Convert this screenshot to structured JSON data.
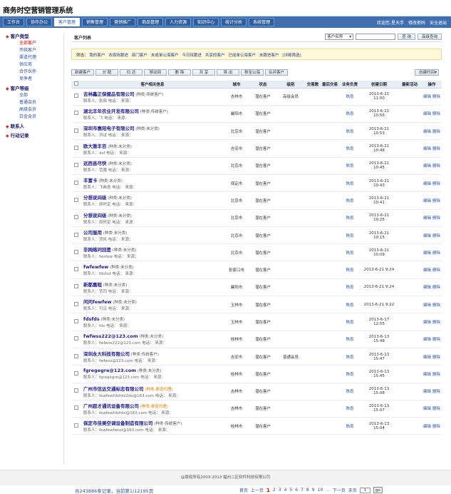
{
  "app": {
    "title": "商务时空营销管理系统"
  },
  "nav": {
    "tabs": [
      "工作台",
      "协作办公",
      "客户管理",
      "销售管理",
      "营销推广",
      "商品管理",
      "人力资源",
      "知识中心",
      "统计分析",
      "系统管理"
    ],
    "active_index": 2,
    "user_links": [
      "欢迎您,星天手",
      "修改密码",
      "安全退出"
    ]
  },
  "sidebar": {
    "groups": [
      {
        "label": "客户类型",
        "items": [
          "全部客户",
          "传统客户",
          "渠道代理",
          "供应商",
          "合作伙伴",
          "竞争者"
        ],
        "active_item": 0
      },
      {
        "label": "客户等级",
        "items": [
          "全部",
          "普通会员",
          "高级会员",
          "白金会员"
        ]
      },
      {
        "label": "联系人",
        "items": []
      },
      {
        "label": "行动记录",
        "items": []
      }
    ]
  },
  "list": {
    "title": "客户列表",
    "search_select": "客户名称",
    "search_placeholder": "",
    "search_button": "查 询",
    "advanced_button": "高级查询"
  },
  "filter": {
    "label": "筛选：",
    "items": [
      "我的客户",
      "本周待跟进",
      "部门客户",
      "未成单公海客户",
      "今日待跟进",
      "共享的客户",
      "已成单公海客户",
      "未跟进客户",
      "[详细筛选]"
    ]
  },
  "toolbar": {
    "buttons": [
      "新建客户",
      "分 配",
      "归 还",
      "移动到",
      "删 除",
      "共 享",
      "导 出",
      "移至公海",
      "合并客户"
    ],
    "sort": "创建时间"
  },
  "table": {
    "headers": [
      "",
      "客户相关信息",
      "城市",
      "状态",
      "级别",
      "交易数",
      "最后交易",
      "业务负责",
      "创建日期",
      "最新活动",
      "操作"
    ],
    "rows": [
      {
        "name": "吉林鑫正保健品有限公司",
        "type": "(种类:传统客户)",
        "type_color": "normal",
        "contact": "联系人：张田  电话：  来源：",
        "city": "吉林市",
        "status": "潜在客户",
        "level": "高级会员",
        "owner": "陈雨",
        "date": "2013-6-21",
        "time": "11:00",
        "ops": [
          "编辑",
          "删除"
        ]
      },
      {
        "name": "湖北丰年农业开发有限公司",
        "type": "(种类:传统客户)",
        "type_color": "normal",
        "contact": "联系人：飞  电话：  来源：",
        "city": "襄阳市",
        "status": "潜在客户",
        "level": "",
        "owner": "陈雨",
        "date": "2013-6-21",
        "time": "10:56",
        "ops": [
          "编辑",
          "删除"
        ]
      },
      {
        "name": "深圳市惠阳电子有限公司",
        "type": "(种类:未分类)",
        "type_color": "normal",
        "contact": "联系人：洪试  电话：  来源：",
        "city": "北京市",
        "status": "潜在客户",
        "level": "",
        "owner": "陈雨",
        "date": "2013-6-21",
        "time": "10:53",
        "ops": [
          "编辑",
          "删除"
        ]
      },
      {
        "name": "欧大雅丰百",
        "type": "(种类:未分类)",
        "type_color": "normal",
        "contact": "联系人：dsf  电话：  来源：",
        "city": "吉安市",
        "status": "潜在客户",
        "level": "",
        "owner": "陈雨",
        "date": "2013-6-21",
        "time": "10:48",
        "ops": [
          "编辑",
          "删除"
        ]
      },
      {
        "name": "远西县尽快",
        "type": "(种类:未分类)",
        "type_color": "normal",
        "contact": "联系人：范围  电话：  来源：",
        "city": "北京市",
        "status": "潜在客户",
        "level": "",
        "owner": "陈雨",
        "date": "2013-6-21",
        "time": "10:45",
        "ops": [
          "编辑",
          "删除"
        ]
      },
      {
        "name": "丰富卡",
        "type": "(种类:未分类)",
        "type_color": "normal",
        "contact": "联系人：飞画舍  电话：  来源：",
        "city": "保定市",
        "status": "潜在客户",
        "level": "",
        "owner": "陈雨",
        "date": "2013-6-21",
        "time": "10:43",
        "ops": [
          "编辑",
          "删除"
        ]
      },
      {
        "name": "分想说间级",
        "type": "(种类:未分类)",
        "type_color": "normal",
        "contact": "联系人：原时定  电话：  来源：",
        "city": "北京市",
        "status": "潜在客户",
        "level": "",
        "owner": "陈雨",
        "date": "2013-6-21",
        "time": "10:41",
        "ops": [
          "编辑",
          "删除"
        ]
      },
      {
        "name": "分想说间级",
        "type": "(种类:未分类)",
        "type_color": "normal",
        "contact": "联系人：原时定  电话：  来源：",
        "city": "北京市",
        "status": "潜在客户",
        "level": "",
        "owner": "陈雨",
        "date": "2013-6-21",
        "time": "10:25",
        "ops": [
          "编辑",
          "删除"
        ]
      },
      {
        "name": "公司服用",
        "type": "(种类:未分类)",
        "type_color": "normal",
        "contact": "联系人：顶风  电话：  来源：",
        "city": "北京市",
        "status": "潜在客户",
        "level": "",
        "owner": "陈雨",
        "date": "2013-6-21",
        "time": "10:15",
        "ops": [
          "编辑",
          "删除"
        ]
      },
      {
        "name": "非网络问回是",
        "type": "(种类:未分类)",
        "type_color": "normal",
        "contact": "联系人：fwsfew  电话：  来源：",
        "city": "北京市",
        "status": "潜在客户",
        "level": "",
        "owner": "陈雨",
        "date": "2013-6-21",
        "time": "10:09",
        "ops": [
          "编辑",
          "删除"
        ]
      },
      {
        "name": "fwfewfew",
        "type": "(种类:未分类)",
        "type_color": "normal",
        "contact": "联系人：fdsfsd  电话：  来源：",
        "city": "张家口市",
        "status": "潜在客户",
        "level": "",
        "owner": "陈雨",
        "date": "2013-6-21 9:24",
        "time": "",
        "ops": [
          "编辑",
          "删除"
        ]
      },
      {
        "name": "新都嘉程",
        "type": "(种类:未分类)",
        "type_color": "normal",
        "contact": "联系人：范司  电话：  来源：",
        "city": "襄阳市",
        "status": "潜在客户",
        "level": "",
        "owner": "陈雨",
        "date": "2013-6-21 9:24",
        "time": "",
        "ops": [
          "编辑",
          "删除"
        ]
      },
      {
        "name": "问问fewfew",
        "type": "(种类:未分类)",
        "type_color": "normal",
        "contact": "联系人：可见  电话：  来源：",
        "city": "玉林市",
        "status": "潜在客户",
        "level": "",
        "owner": "陈雨",
        "date": "2013-6-21 9:22",
        "time": "",
        "ops": [
          "编辑",
          "删除"
        ]
      },
      {
        "name": "fdsfds",
        "type": "(种类:未分类)",
        "type_color": "normal",
        "contact": "联系人：fds  电话：  来源：",
        "city": "玉林市",
        "status": "潜在客户",
        "level": "",
        "owner": "陈雨",
        "date": "2013-6-17",
        "time": "12:55",
        "ops": [
          "编辑",
          "删除"
        ]
      },
      {
        "name": "fwfwss222@123.com",
        "type": "(种类:未分类)",
        "type_color": "normal",
        "contact": "联系人：fwfwss222@123.com  电话：  来源：",
        "city": "桂林市",
        "status": "潜在客户",
        "level": "",
        "owner": "陈雨",
        "date": "2013-6-13",
        "time": "15:48",
        "ops": [
          "编辑",
          "删除"
        ]
      },
      {
        "name": "深圳永大科技有限公司",
        "type": "(种类:传统客户)",
        "type_color": "normal",
        "contact": "联系人：fwfwss@123.com  电话：  来源：",
        "city": "吉安市",
        "status": "潜在客户",
        "level": "普通会员",
        "owner": "陈雨",
        "date": "2013-6-13",
        "time": "15:47",
        "ops": [
          "编辑",
          "删除"
        ]
      },
      {
        "name": "fgregegre@123.com",
        "type": "(种类:未分类)",
        "type_color": "normal",
        "contact": "联系人：fgregegre@123.com  电话：  来源：",
        "city": "桂林市",
        "status": "潜在客户",
        "level": "",
        "owner": "陈雨",
        "date": "2013-6-13",
        "time": "15:45",
        "ops": [
          "编辑",
          "删除"
        ]
      },
      {
        "name": "广州市信达交通标志有限公司",
        "type": "(种类:渠道代理)",
        "type_color": "orange",
        "contact": "联系人：fewfewfdsfdsl2ds@163.com  电话：  来源：",
        "city": "吉林市",
        "status": "潜在客户",
        "level": "",
        "owner": "陈雨",
        "date": "2013-6-13",
        "time": "15:08",
        "ops": [
          "编辑",
          "删除"
        ]
      },
      {
        "name": "广州超才通讯设备有限公司",
        "type": "(种类:渠道代理)",
        "type_color": "orange",
        "contact": "联系人：fewfewfdsfdsl@163.com  电话：  来源：",
        "city": "吉林市",
        "status": "潜在客户",
        "level": "",
        "owner": "陈雨",
        "date": "2013-6-13",
        "time": "15:07",
        "ops": [
          "编辑",
          "删除"
        ]
      },
      {
        "name": "保定市佳美空调设备制造有限公司",
        "type": "(种类:传统客户)",
        "type_color": "normal",
        "contact": "联系人：fewfewfwssl@163.com  电话：  来源：",
        "city": "桂林市",
        "status": "潜在客户",
        "level": "",
        "owner": "陈雨",
        "date": "2013-6-13",
        "time": "15:04",
        "ops": [
          "编辑",
          "删除"
        ]
      }
    ]
  },
  "pager": {
    "summary": "共243886条记录，当前第1/12195页",
    "first": "首页",
    "prev": "上一页",
    "pages": [
      "1",
      "2",
      "3",
      "4",
      "5",
      "6",
      "7",
      "8",
      "9",
      "10"
    ],
    "current": "1",
    "ellipsis": "...",
    "next": "下一页",
    "last": "末页",
    "jump_value": "1",
    "go": "go"
  },
  "footer": {
    "text": "@版权所有2003-2013 福州二区软件科技有限公司"
  },
  "colors": {
    "nav_bg": "#3f6fb1",
    "link": "#2a4ea0",
    "active": "#dd0000",
    "filter_bg": "#fff8db"
  }
}
